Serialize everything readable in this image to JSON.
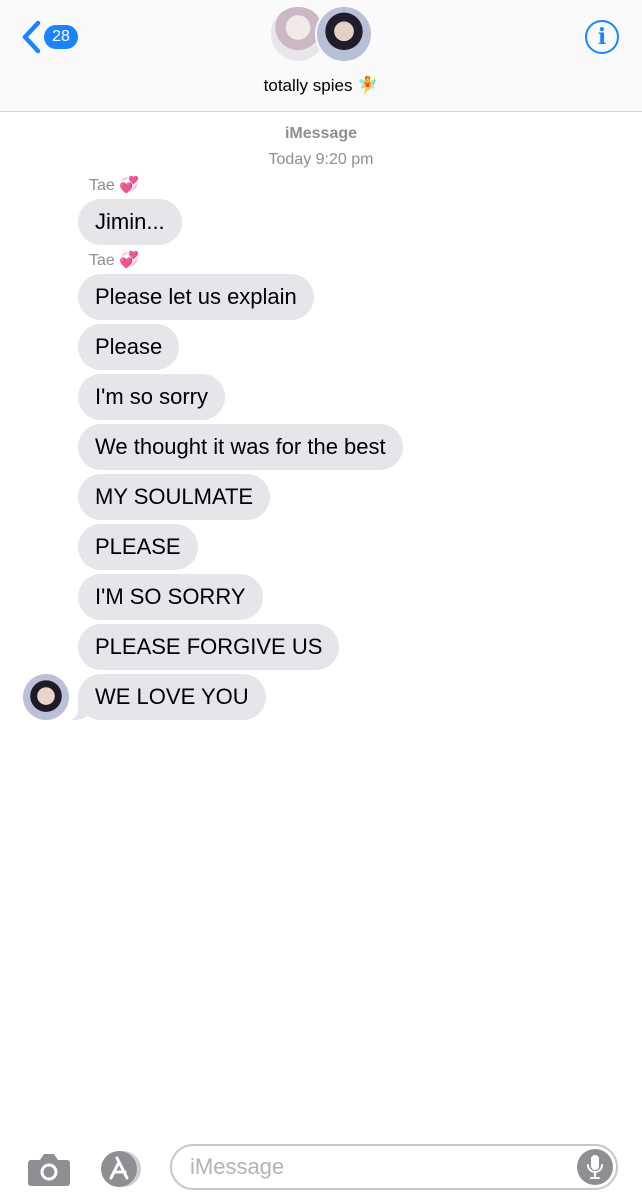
{
  "header": {
    "back_count": "28",
    "group_title": "totally spies 🧚",
    "accent_color": "#1a84ff",
    "back_icon": "chevron-left-icon",
    "info_icon": "info-icon",
    "info_glyph": "i"
  },
  "conversation": {
    "service": "iMessage",
    "timestamp": "Today 9:20 pm"
  },
  "messages": [
    {
      "sender": "Tae 💞",
      "text": "Jimin..."
    },
    {
      "sender": "Tae 💞",
      "text": "Please let us explain"
    },
    {
      "text": "Please"
    },
    {
      "text": "I'm so sorry"
    },
    {
      "text": "We thought it was for the best"
    },
    {
      "text": "MY SOULMATE"
    },
    {
      "text": "PLEASE"
    },
    {
      "text": "I'M SO SORRY"
    },
    {
      "text": "PLEASE FORGIVE US"
    },
    {
      "text": "WE LOVE YOU"
    }
  ],
  "bubble_color": "#e5e5ea",
  "compose": {
    "placeholder": "iMessage",
    "value": "",
    "camera_icon": "camera-icon",
    "apps_icon": "app-store-icon",
    "mic_icon": "microphone-icon"
  }
}
